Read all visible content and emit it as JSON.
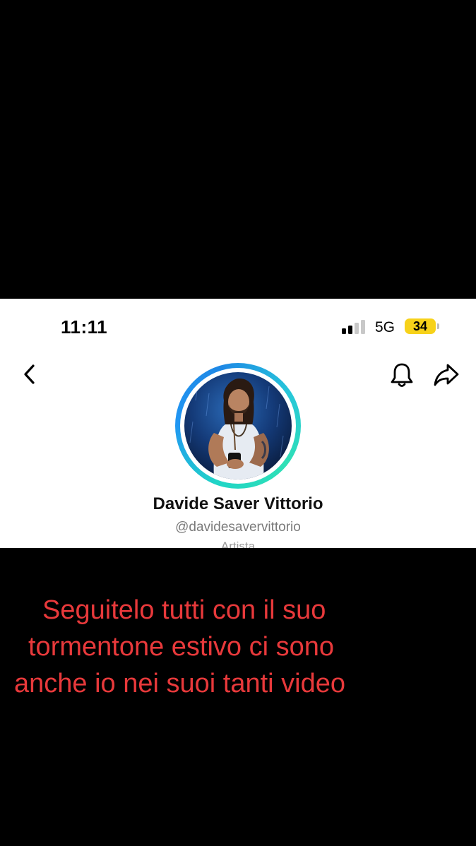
{
  "status_bar": {
    "time": "11:11",
    "network": "5G",
    "battery": "34",
    "battery_color": "#f7d21a"
  },
  "header": {
    "back_icon": "chevron-left-icon",
    "notification_icon": "bell-icon",
    "share_icon": "share-arrow-icon"
  },
  "profile": {
    "name": "Davide Saver Vittorio",
    "handle": "@davidesavervittorio",
    "category": "Artista",
    "ring_colors": [
      "#20d5c6",
      "#2196f3"
    ]
  },
  "caption": {
    "lines": [
      "Seguitelo tutti con il suo",
      "tormentone estivo ci sono",
      "anche io nei suoi tanti video"
    ],
    "color": "#e8393b"
  }
}
